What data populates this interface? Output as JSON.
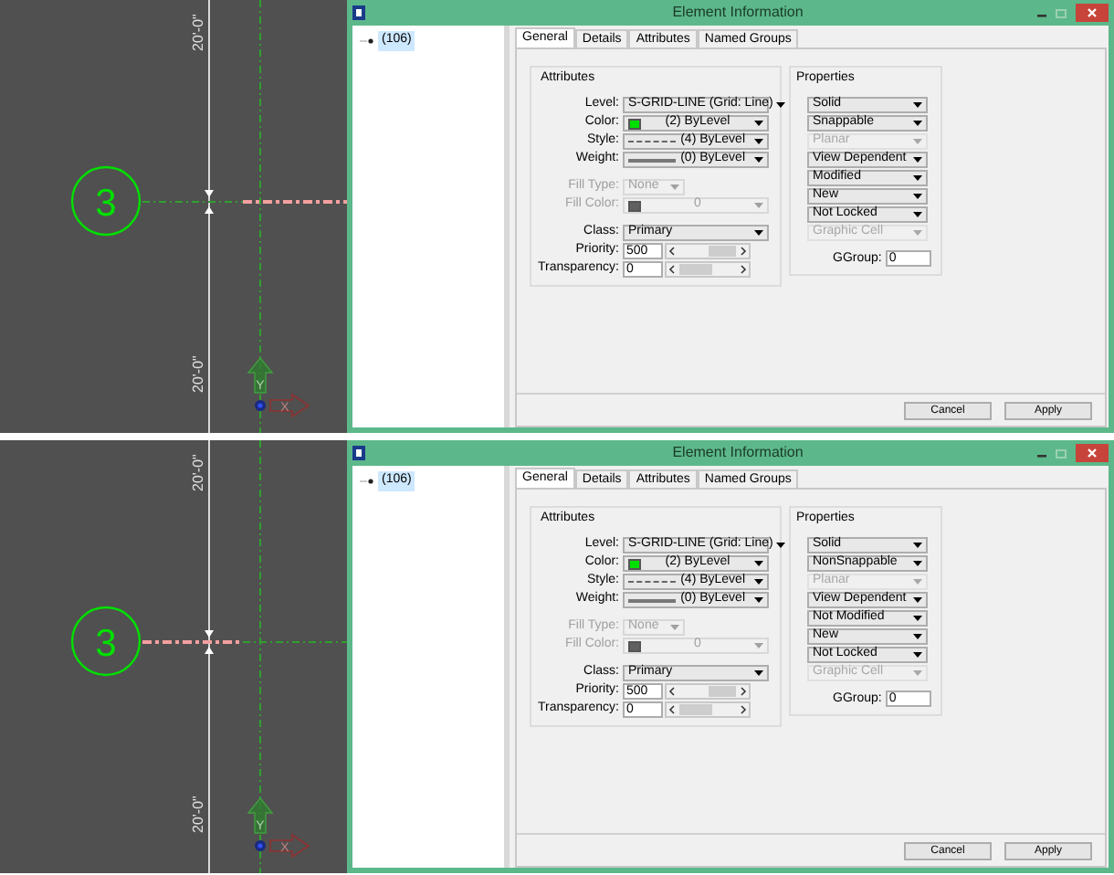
{
  "panels": [
    {
      "cad": {
        "dimension_labels": [
          "20'-0\"",
          "20'-0\""
        ],
        "grid_bubble": "3",
        "highlighted_left": false,
        "highlighted_right": true,
        "axis_labels": [
          "Y",
          "X"
        ]
      },
      "dialog": {
        "title": "Element Information",
        "tree": [
          {
            "label": "(106)",
            "selected": true
          }
        ],
        "tabs": [
          {
            "label": "General",
            "selected": true
          },
          {
            "label": "Details",
            "selected": false
          },
          {
            "label": "Attributes",
            "selected": false
          },
          {
            "label": "Named Groups",
            "selected": false
          }
        ],
        "attributes": {
          "title": "Attributes",
          "row_groups": [
            [
              {
                "kind": "select",
                "label": "Level:",
                "value": "S-GRID-LINE (Grid: Line)",
                "disabled": false
              },
              {
                "kind": "color_select",
                "label": "Color:",
                "value": "(2) ByLevel",
                "color": "#00e000",
                "disabled": false
              },
              {
                "kind": "style_select",
                "label": "Style:",
                "value": "(4) ByLevel",
                "disabled": false
              },
              {
                "kind": "weight_select",
                "label": "Weight:",
                "value": "(0) ByLevel",
                "disabled": false
              }
            ],
            [
              {
                "kind": "short_select",
                "label": "Fill Type:",
                "value": "None",
                "disabled": true
              },
              {
                "kind": "color_select",
                "label": "Fill Color:",
                "value": "0",
                "color": "#606060",
                "disabled": true
              }
            ],
            [
              {
                "kind": "select",
                "label": "Class:",
                "value": "Primary",
                "disabled": false
              },
              {
                "kind": "number",
                "label": "Priority:",
                "value": "500",
                "disabled": false
              },
              {
                "kind": "number",
                "label": "Transparency:",
                "value": "0",
                "disabled": false
              }
            ]
          ]
        },
        "properties": {
          "title": "Properties",
          "items": [
            {
              "label": "Solid",
              "disabled": false
            },
            {
              "label": "Snappable",
              "disabled": false
            },
            {
              "label": "Planar",
              "disabled": true
            },
            {
              "label": "View Dependent",
              "disabled": false
            },
            {
              "label": "Modified",
              "disabled": false
            },
            {
              "label": "New",
              "disabled": false
            },
            {
              "label": "Not Locked",
              "disabled": false
            },
            {
              "label": "Graphic Cell",
              "disabled": true
            }
          ],
          "ggroup": {
            "label": "GGroup:",
            "value": "0"
          }
        },
        "buttons": [
          "Cancel",
          "Apply"
        ]
      }
    },
    {
      "cad": {
        "dimension_labels": [
          "20'-0\"",
          "20'-0\""
        ],
        "grid_bubble": "3",
        "highlighted_left": true,
        "highlighted_right": false,
        "axis_labels": [
          "Y",
          "X"
        ]
      },
      "dialog": {
        "title": "Element Information",
        "tree": [
          {
            "label": "(106)",
            "selected": true
          }
        ],
        "tabs": [
          {
            "label": "General",
            "selected": true
          },
          {
            "label": "Details",
            "selected": false
          },
          {
            "label": "Attributes",
            "selected": false
          },
          {
            "label": "Named Groups",
            "selected": false
          }
        ],
        "attributes": {
          "title": "Attributes",
          "row_groups": [
            [
              {
                "kind": "select",
                "label": "Level:",
                "value": "S-GRID-LINE (Grid: Line)",
                "disabled": false
              },
              {
                "kind": "color_select",
                "label": "Color:",
                "value": "(2) ByLevel",
                "color": "#00e000",
                "disabled": false
              },
              {
                "kind": "style_select",
                "label": "Style:",
                "value": "(4) ByLevel",
                "disabled": false
              },
              {
                "kind": "weight_select",
                "label": "Weight:",
                "value": "(0) ByLevel",
                "disabled": false
              }
            ],
            [
              {
                "kind": "short_select",
                "label": "Fill Type:",
                "value": "None",
                "disabled": true
              },
              {
                "kind": "color_select",
                "label": "Fill Color:",
                "value": "0",
                "color": "#606060",
                "disabled": true
              }
            ],
            [
              {
                "kind": "select",
                "label": "Class:",
                "value": "Primary",
                "disabled": false
              },
              {
                "kind": "number",
                "label": "Priority:",
                "value": "500",
                "disabled": false
              },
              {
                "kind": "number",
                "label": "Transparency:",
                "value": "0",
                "disabled": false
              }
            ]
          ]
        },
        "properties": {
          "title": "Properties",
          "items": [
            {
              "label": "Solid",
              "disabled": false
            },
            {
              "label": "NonSnappable",
              "disabled": false
            },
            {
              "label": "Planar",
              "disabled": true
            },
            {
              "label": "View Dependent",
              "disabled": false
            },
            {
              "label": "Not Modified",
              "disabled": false
            },
            {
              "label": "New",
              "disabled": false
            },
            {
              "label": "Not Locked",
              "disabled": false
            },
            {
              "label": "Graphic Cell",
              "disabled": true
            }
          ],
          "ggroup": {
            "label": "GGroup:",
            "value": "0"
          }
        },
        "buttons": [
          "Cancel",
          "Apply"
        ]
      }
    }
  ]
}
